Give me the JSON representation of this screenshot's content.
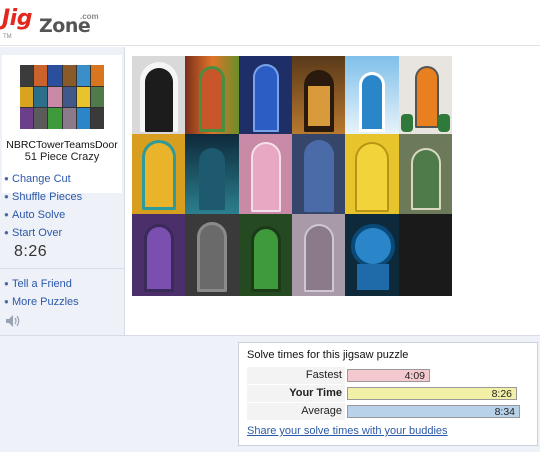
{
  "logo": {
    "jig": "Jig",
    "zone": "Zone",
    "dotcom": ".com",
    "tm": "TM"
  },
  "sidebar": {
    "thumb_name": "NBRCTowerTeamsDoor",
    "piece_info": "51 Piece Crazy",
    "menu_primary": [
      {
        "label": "Change Cut"
      },
      {
        "label": "Shuffle Pieces"
      },
      {
        "label": "Auto Solve"
      },
      {
        "label": "Start Over"
      }
    ],
    "timer": "8:26",
    "menu_secondary": [
      {
        "label": "Tell a Friend"
      },
      {
        "label": "More Puzzles"
      }
    ],
    "sound_icon": "speaker-icon"
  },
  "solve_times": {
    "title": "Solve times for this jigsaw puzzle",
    "rows": [
      {
        "label": "Fastest",
        "value": "4:09",
        "fill": 0.49,
        "color": "#f3c9cf"
      },
      {
        "label": "Your Time",
        "value": "8:26",
        "fill": 1.0,
        "color": "#f1f0a6"
      },
      {
        "label": "Average",
        "value": "8:34",
        "fill": 1.02,
        "color": "#b8d2ea"
      }
    ],
    "share_link": "Share your solve times with your buddies"
  },
  "colors": {
    "link": "#2c58a8",
    "logo_red": "#e2281c",
    "sidebar_bg": "#eef1f7"
  }
}
